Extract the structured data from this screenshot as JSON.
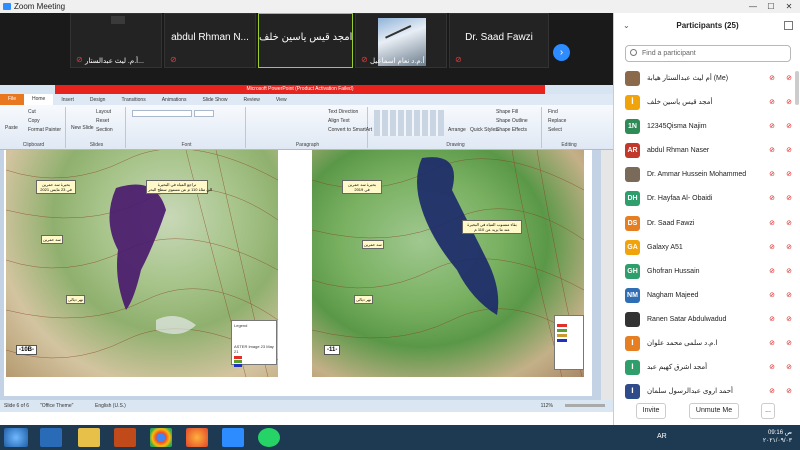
{
  "window": {
    "title": "Zoom Meeting"
  },
  "video_strip": {
    "tiles": [
      {
        "name": "",
        "label": "أ.م. ليث عبدالستار..."
      },
      {
        "name": "abdul Rhman N...",
        "label": ""
      },
      {
        "name": "أمجد قيس ياسين خلف",
        "label": ""
      },
      {
        "name": "",
        "label": "أ.م.د نعام اسماعيل"
      },
      {
        "name": "Dr. Saad Fawzi",
        "label": ""
      }
    ],
    "next_icon": "chevron-right-icon"
  },
  "powerpoint": {
    "title": "Microsoft PowerPoint (Product Activation Failed)",
    "file_tab": "File",
    "tabs": [
      "Home",
      "Insert",
      "Design",
      "Transitions",
      "Animations",
      "Slide Show",
      "Review",
      "View"
    ],
    "ribbon_groups": [
      "Clipboard",
      "Slides",
      "Font",
      "Paragraph",
      "Drawing",
      "Editing"
    ],
    "clipboard_items": [
      "Paste",
      "Cut",
      "Copy",
      "Format Painter"
    ],
    "slides_items": [
      "New Slide",
      "Layout",
      "Reset",
      "Section"
    ],
    "paragraph_items": [
      "Text Direction",
      "Align Text",
      "Convert to SmartArt"
    ],
    "drawing_items": [
      "Arrange",
      "Quick Styles",
      "Shape Fill",
      "Shape Outline",
      "Shape Effects"
    ],
    "editing_items": [
      "Find",
      "Replace",
      "Select"
    ],
    "slide": {
      "left_panel_label": "-10B-",
      "right_panel_label": "-11-",
      "left_callout": "بحيرة سد حمرين\nفي 23 مايس 2021",
      "left_callout2": "تراجع المياه في البحيرة\nالى مئاة 110 م عن مستوى سطح البحر",
      "left_callout3": "سد حمرين",
      "left_callout4": "نهر ديالى",
      "right_callout": "بحيرة سد حمرين\nفي 2019",
      "right_callout2": "بقاء منسوب المياه في البحيرة\nعند ما يزيد عن 110 م",
      "right_callout3": "سد حمرين",
      "right_callout4": "نهر ديالى",
      "legend_title": "Legend",
      "legend_caption": "ASTER Image 23 May 21"
    },
    "status": {
      "slide": "Slide 6 of 6",
      "theme": "\"Office Theme\"",
      "language": "English (U.S.)",
      "zoom": "112%"
    }
  },
  "participants": {
    "title": "Participants (25)",
    "search_placeholder": "Find a participant",
    "list": [
      {
        "name": "أم ليث عبدالستار هيابة (Me)",
        "initials": "",
        "color": "#8a6a4a"
      },
      {
        "name": "أمجد قيس ياسين خلف",
        "initials": "أ",
        "color": "#f0a30a"
      },
      {
        "name": "12345Qisma Najim",
        "initials": "1N",
        "color": "#2e8b57"
      },
      {
        "name": "abdul Rhman Naser",
        "initials": "AR",
        "color": "#c0392b"
      },
      {
        "name": "Dr. Ammar Hussein Mohammed",
        "initials": "",
        "color": "#7a6a5a"
      },
      {
        "name": "Dr. Hayfaa Al- Obaidi",
        "initials": "DH",
        "color": "#2e9e6a"
      },
      {
        "name": "Dr. Saad Fawzi",
        "initials": "DS",
        "color": "#e67e22"
      },
      {
        "name": "Galaxy A51",
        "initials": "GA",
        "color": "#f0a30a"
      },
      {
        "name": "Ghofran Hussain",
        "initials": "GH",
        "color": "#2e9e6a"
      },
      {
        "name": "Nagham Majeed",
        "initials": "NM",
        "color": "#2f6db5"
      },
      {
        "name": "Ranen Satar Abdulwadud",
        "initials": "",
        "color": "#333333"
      },
      {
        "name": "ا.م.د سلمى محمد علوان",
        "initials": "ا",
        "color": "#e67e22"
      },
      {
        "name": "أمجد اشرق كهيم عبد",
        "initials": "ا",
        "color": "#2e9e6a"
      },
      {
        "name": "أحمد اروى عبدالرسول سلمان",
        "initials": "ا",
        "color": "#2f4b8a"
      }
    ],
    "invite": "Invite",
    "unmute": "Unmute Me",
    "more": "..."
  },
  "taskbar": {
    "lang": "AR",
    "time": "09:16 ص",
    "date": "٢٠٢١/٠٩/٠٣"
  }
}
